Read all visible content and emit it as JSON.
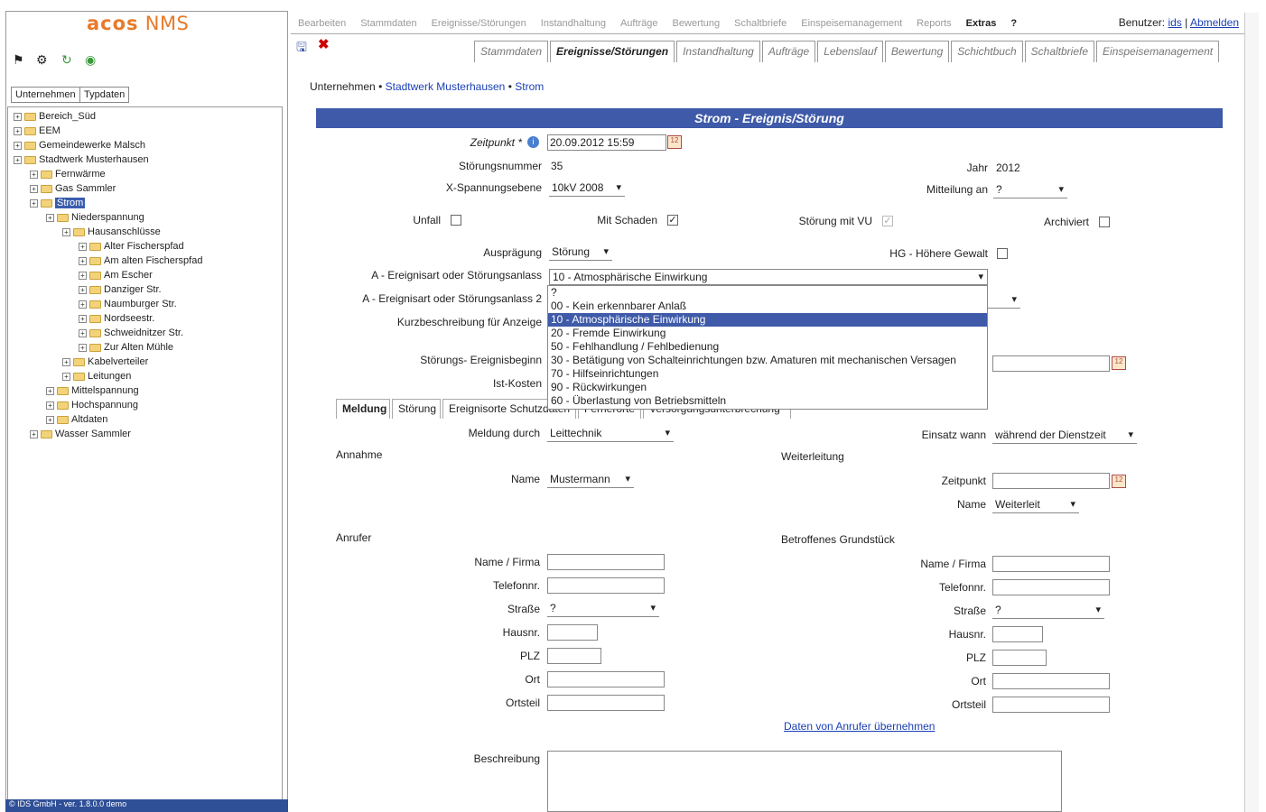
{
  "app": {
    "logo_acos": "acos",
    "logo_nms": "NMS"
  },
  "left": {
    "tabs": [
      "Unternehmen",
      "Typdaten"
    ],
    "tree": [
      {
        "label": "Bereich_Süd",
        "level": 0
      },
      {
        "label": "EEM",
        "level": 0
      },
      {
        "label": "Gemeindewerke Malsch",
        "level": 0
      },
      {
        "label": "Stadtwerk Musterhausen",
        "level": 0
      },
      {
        "label": "Fernwärme",
        "level": 1
      },
      {
        "label": "Gas Sammler",
        "level": 1
      },
      {
        "label": "Strom",
        "level": 1,
        "selected": true
      },
      {
        "label": "Niederspannung",
        "level": 2
      },
      {
        "label": "Hausanschlüsse",
        "level": 3
      },
      {
        "label": "Alter Fischerspfad",
        "level": 4
      },
      {
        "label": "Am alten Fischerspfad",
        "level": 4
      },
      {
        "label": "Am Escher",
        "level": 4
      },
      {
        "label": "Danziger Str.",
        "level": 4
      },
      {
        "label": "Naumburger Str.",
        "level": 4
      },
      {
        "label": "Nordseestr.",
        "level": 4
      },
      {
        "label": "Schweidnitzer Str.",
        "level": 4
      },
      {
        "label": "Zur Alten Mühle",
        "level": 4
      },
      {
        "label": "Kabelverteiler",
        "level": 3
      },
      {
        "label": "Leitungen",
        "level": 3
      },
      {
        "label": "Mittelspannung",
        "level": 2
      },
      {
        "label": "Hochspannung",
        "level": 2
      },
      {
        "label": "Altdaten",
        "level": 2
      },
      {
        "label": "Wasser Sammler",
        "level": 1
      }
    ],
    "footer": "© IDS GmbH - ver. 1.8.0.0 demo"
  },
  "topmenu": [
    "Bearbeiten",
    "Stammdaten",
    "Ereignisse/Störungen",
    "Instandhaltung",
    "Aufträge",
    "Bewertung",
    "Schaltbriefe",
    "Einspeisemanagement",
    "Reports",
    "Extras",
    "?"
  ],
  "user": {
    "label": "Benutzer:",
    "name": "ids",
    "sep": "|",
    "logout": "Abmelden"
  },
  "tabs2": [
    "Stammdaten",
    "Ereignisse/Störungen",
    "Instandhaltung",
    "Aufträge",
    "Lebenslauf",
    "Bewertung",
    "Schichtbuch",
    "Schaltbriefe",
    "Einspeisemanagement"
  ],
  "breadcrumb": {
    "prefix": "Unternehmen",
    "sep": "•",
    "company": "Stadtwerk Musterhausen",
    "area": "Strom"
  },
  "form": {
    "title": "Strom - Ereignis/Störung",
    "zeitpunkt_label": "Zeitpunkt *",
    "zeitpunkt": "20.09.2012 15:59",
    "stoerungsnr_label": "Störungsnummer",
    "stoerungsnr": "35",
    "jahr_label": "Jahr",
    "jahr": "2012",
    "spannung_label": "X-Spannungsebene",
    "spannung": "10kV 2008",
    "mitteilung_label": "Mitteilung an",
    "mitteilung": "?",
    "unfall_label": "Unfall",
    "schaden_label": "Mit Schaden",
    "stoerung_vu_label": "Störung mit VU",
    "archiviert_label": "Archiviert",
    "auspraegung_label": "Ausprägung",
    "auspraegung": "Störung",
    "hg_label": "HG - Höhere Gewalt",
    "ereignisart1_label": "A - Ereignisart oder Störungsanlass",
    "ereignisart1": "10 - Atmosphärische Einwirkung",
    "ereignisart2_label": "A - Ereignisart oder Störungsanlass 2",
    "kurz_label": "Kurzbeschreibung für Anzeige",
    "beginn_label": "Störungs- Ereignisbeginn",
    "kosten_label": "Ist-Kosten",
    "options": [
      "?",
      "00 - Kein erkennbarer Anlaß",
      "10 - Atmosphärische Einwirkung",
      "20 - Fremde Einwirkung",
      "50 - Fehlhandlung / Fehlbedienung",
      "30 - Betätigung von Schalteinrichtungen bzw. Amaturen mit mechanischen Versagen",
      "70 - Hilfseinrichtungen",
      "90 - Rückwirkungen",
      "60 - Überlastung von Betriebsmitteln"
    ]
  },
  "tabs3": [
    "Meldung",
    "Störung",
    "Ereignisorte Schutzdaten",
    "Fernerorte",
    "Versorgungsunterbrechung"
  ],
  "meldung": {
    "meldung_durch_label": "Meldung durch",
    "meldung_durch": "Leittechnik",
    "einsatz_label": "Einsatz wann",
    "einsatz": "während der Dienstzeit",
    "annahme": "Annahme",
    "name_label": "Name",
    "name": "Mustermann",
    "weiterleitung": "Weiterleitung",
    "zeitpunkt_label": "Zeitpunkt",
    "wname_label": "Name",
    "wname": "Weiterleit",
    "anrufer": "Anrufer",
    "grundstueck": "Betroffenes Grundstück",
    "fields": [
      "Name / Firma",
      "Telefonnr.",
      "Straße",
      "Hausnr.",
      "PLZ",
      "Ort",
      "Ortsteil"
    ],
    "strasse": "?",
    "uebernehmen": "Daten von Anrufer übernehmen",
    "beschreibung_label": "Beschreibung"
  }
}
